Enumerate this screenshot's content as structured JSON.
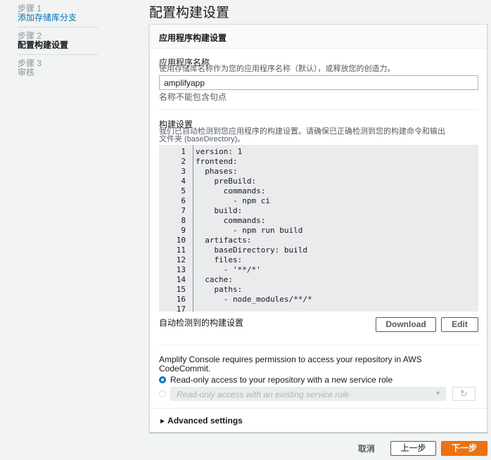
{
  "steps": [
    {
      "num": "步骤 1",
      "name": "添加存储库分支"
    },
    {
      "num": "步骤 2",
      "name": "配置构建设置"
    },
    {
      "num": "步骤 3",
      "name": "审核"
    }
  ],
  "page_title": "配置构建设置",
  "panel": {
    "header": "应用程序构建设置",
    "app_name": {
      "label": "应用程序名称",
      "description": "使用存储库名称作为您的应用程序名称（默认），或释放您的创造力。",
      "value": "amplifyapp",
      "hint": "名称不能包含句点"
    },
    "build_settings": {
      "label": "构建设置",
      "description_line1": "我们已自动检测到您应用程序的构建设置。请确保已正确检测到您的构建命令和输出",
      "description_line2": "文件夹 (baseDirectory)。",
      "code_lines": [
        {
          "n": "1",
          "t": "version: 1"
        },
        {
          "n": "2",
          "t": "frontend:"
        },
        {
          "n": "3",
          "t": "  phases:"
        },
        {
          "n": "4",
          "t": "    preBuild:"
        },
        {
          "n": "5",
          "t": "      commands:"
        },
        {
          "n": "6",
          "t": "        - npm ci"
        },
        {
          "n": "7",
          "t": "    build:"
        },
        {
          "n": "8",
          "t": "      commands:"
        },
        {
          "n": "9",
          "t": "        - npm run build"
        },
        {
          "n": "10",
          "t": "  artifacts:"
        },
        {
          "n": "11",
          "t": "    baseDirectory: build"
        },
        {
          "n": "12",
          "t": "    files:"
        },
        {
          "n": "13",
          "t": "      - '**/*'"
        },
        {
          "n": "14",
          "t": "  cache:"
        },
        {
          "n": "15",
          "t": "    paths:"
        },
        {
          "n": "16",
          "t": "      - node_modules/**/*"
        },
        {
          "n": "17",
          "t": ""
        }
      ],
      "auto_detected": "自动检测到的构建设置",
      "download_label": "Download",
      "edit_label": "Edit"
    },
    "permission": {
      "text_line1": "Amplify Console requires permission to access your repository in AWS",
      "text_line2": "CodeCommit.",
      "option1": "Read-only access to your repository with a new service role",
      "option2_placeholder": "Read-only access with an existing service role"
    },
    "advanced": "Advanced settings"
  },
  "footer": {
    "cancel": "取消",
    "prev": "上一步",
    "next": "下一步"
  },
  "icons": {
    "dropdown": "chevron-down-icon",
    "refresh": "refresh-icon",
    "expand": "caret-right-icon"
  },
  "colors": {
    "link": "#0073bb",
    "primary": "#ec7211",
    "background": "#f2f3f3"
  }
}
